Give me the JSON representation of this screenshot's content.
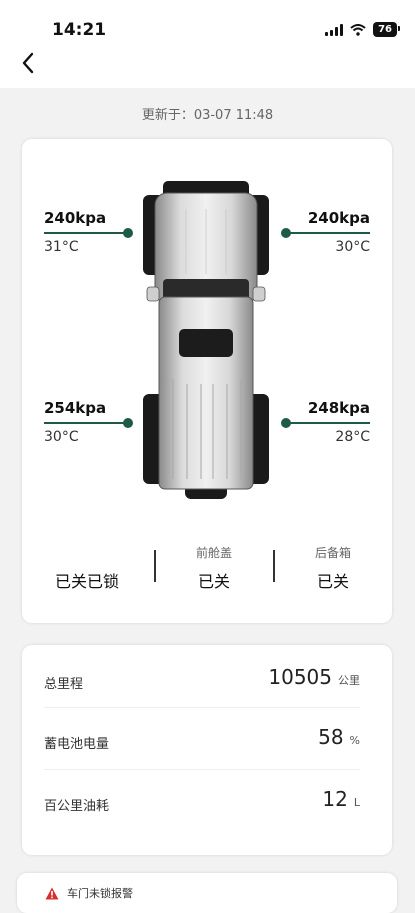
{
  "status_bar": {
    "time": "14:21",
    "battery": "76"
  },
  "updated_label": "更新于：03-07  11:48",
  "tires": {
    "front_left": {
      "pressure": "240kpa",
      "temp": "31°C"
    },
    "front_right": {
      "pressure": "240kpa",
      "temp": "30°C"
    },
    "rear_left": {
      "pressure": "254kpa",
      "temp": "30°C"
    },
    "rear_right": {
      "pressure": "248kpa",
      "temp": "28°C"
    }
  },
  "status": [
    {
      "label": "",
      "value": "已关已锁"
    },
    {
      "label": "前舱盖",
      "value": "已关"
    },
    {
      "label": "后备箱",
      "value": "已关"
    }
  ],
  "stats": [
    {
      "label": "总里程",
      "value": "10505",
      "unit": "公里"
    },
    {
      "label": "蓄电池电量",
      "value": "58",
      "unit": "%"
    },
    {
      "label": "百公里油耗",
      "value": "12",
      "unit": "L"
    }
  ],
  "alert": {
    "text": "车门未锁报警",
    "icon": "warning-icon"
  },
  "colors": {
    "accent": "#1e5b45",
    "alert": "#d62f2f"
  }
}
